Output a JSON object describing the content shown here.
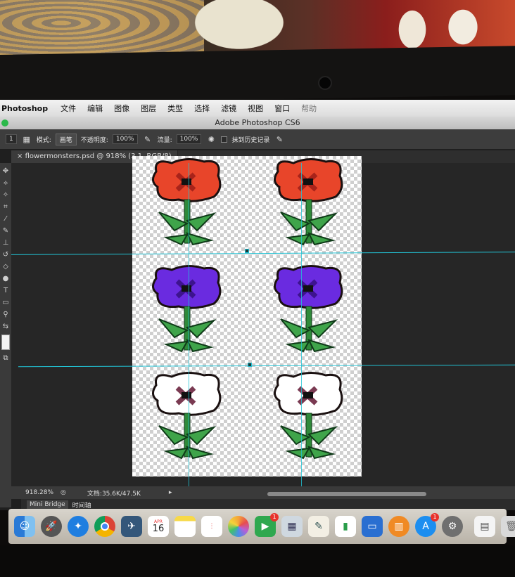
{
  "menubar": {
    "app_name": "Photoshop",
    "items": [
      "文件",
      "编辑",
      "图像",
      "图层",
      "类型",
      "选择",
      "滤镜",
      "视图",
      "窗口",
      "帮助"
    ]
  },
  "window": {
    "title": "Adobe Photoshop CS6"
  },
  "options_bar": {
    "brush_size": "1",
    "mode_label": "模式:",
    "mode_value": "画笔",
    "opacity_label": "不透明度:",
    "opacity_value": "100%",
    "flow_label": "流量:",
    "flow_value": "100%",
    "history_label": "抹到历史记录"
  },
  "document_tab": {
    "label": "flowermonsters.psd @ 918% (3.1, RGB/8)"
  },
  "status_bar": {
    "zoom": "918.28%",
    "doc_info": "文档:35.6K/47.5K"
  },
  "bridge_tabs": [
    "Mini Bridge",
    "时间轴"
  ],
  "dock": {
    "calendar_month": "APR",
    "calendar_day": "16",
    "facetime_badge": "1",
    "appstore_badge": "1"
  },
  "sprites": [
    {
      "color": "#e8452a",
      "dark": "#a8231a"
    },
    {
      "color": "#e8452a",
      "dark": "#a8231a"
    },
    {
      "color": "#6a2be0",
      "dark": "#3d138f"
    },
    {
      "color": "#6a2be0",
      "dark": "#3d138f"
    },
    {
      "color": "#ffffff",
      "dark": "#7a3a52"
    },
    {
      "color": "#ffffff",
      "dark": "#7a3a52"
    }
  ]
}
